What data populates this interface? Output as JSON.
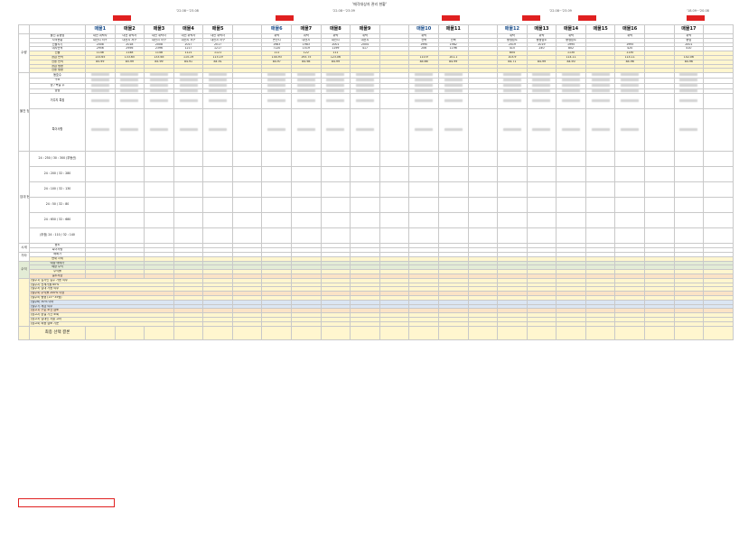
{
  "top_caption": "'매각대상자 관리 현황'",
  "dates": [
    "'22.08~'23.08",
    "'22.08~'23.09",
    "'22.08~'23.09",
    "'18.09~'20.08"
  ],
  "header": {
    "corner": "",
    "columns": [
      "매물1",
      "매물2",
      "매물3",
      "매물4",
      "매물5",
      "",
      "매물6",
      "매물7",
      "매물8",
      "매물9",
      "",
      "매물10",
      "매물11",
      "",
      "매물12",
      "매물13",
      "매물14",
      "매물15",
      "매물16",
      "",
      "매물17",
      ""
    ]
  },
  "sections": {
    "s1": "수량",
    "s2": "물건 정보",
    "s3": "임대 현황",
    "s4": "시세",
    "s5": "기타",
    "s6": "수익"
  },
  "rows": [
    {
      "label": "물건 유형명",
      "cells": [
        "대전 위탁사",
        "대전 위탁사",
        "대전 위탁사",
        "대전 위탁사",
        "대전 위탁사",
        "",
        "위탁",
        "위탁",
        "위탁",
        "위탁",
        "",
        "위탁",
        "",
        "",
        "위탁",
        "위탁",
        "위탁",
        "",
        "위탁",
        "",
        "위탁",
        ""
      ]
    },
    {
      "label": "지역현황",
      "cells": [
        "대전시 서구",
        "대전시 서구",
        "대전시 서구",
        "대전시 서구",
        "대전시 서구",
        "",
        "논산시",
        "대전시",
        "대전시",
        "대전시",
        "",
        "전북",
        "전북",
        "",
        "충청남도",
        "충청남도",
        "충청남도",
        "",
        "",
        "",
        "충남",
        ""
      ]
    },
    {
      "label": "건물시기",
      "cells": [
        "2008",
        "2018",
        "2008",
        "2017",
        "2017",
        "",
        "1983",
        "1983",
        "2001",
        "2004",
        "",
        "1990",
        "1982",
        "",
        "2019",
        "2019",
        "1995",
        "",
        "1995",
        "",
        "2001",
        ""
      ]
    },
    {
      "label": "대지면적",
      "cells": [
        "2956",
        "2956",
        "2396",
        "1217",
        "1217",
        "",
        "7120",
        "1519",
        "1199",
        "417",
        "",
        "206",
        "1196",
        "",
        "415",
        "240",
        "802",
        "",
        "420",
        "",
        "410",
        ""
      ]
    },
    {
      "label": "건물",
      "cells": [
        "1148",
        "1148",
        "1148",
        "1121",
        "1121",
        "",
        "111",
        "122",
        "111",
        "",
        "",
        "",
        "",
        "",
        "804",
        "",
        "1130",
        "",
        "1130",
        "",
        "",
        ""
      ]
    },
    {
      "label": "공급 면적",
      "cells": [
        "133.65",
        "133.65",
        "133.65",
        "115.19",
        "115.19",
        "",
        "144.93",
        "193.75",
        "123.06",
        "",
        "",
        "110.9",
        "101.1",
        "",
        "103.9",
        "",
        "114.11",
        "",
        "114.11",
        "",
        "102.06",
        ""
      ]
    },
    {
      "label": "전용 면적",
      "cells": [
        "85.99",
        "85.99",
        "85.99",
        "84.91",
        "84.91",
        "",
        "84.97",
        "84.98",
        "84.99",
        "",
        "",
        "84.66",
        "84.99",
        "",
        "84.71",
        "84.99",
        "84.90",
        "",
        "84.96",
        "",
        "84.96",
        ""
      ]
    },
    {
      "label": "공급 평형",
      "cells": [
        "",
        "",
        "",
        "",
        "",
        "",
        "",
        "",
        "",
        "",
        "",
        "",
        "",
        "",
        "",
        "",
        "",
        "",
        "",
        "",
        "",
        ""
      ]
    },
    {
      "label": "전용 평형",
      "cells": [
        "",
        "",
        "",
        "",
        "",
        "",
        "",
        "",
        "",
        "",
        "",
        "",
        "",
        "",
        "",
        "",
        "",
        "",
        "",
        "",
        "",
        ""
      ]
    },
    {
      "label": "동호수",
      "cells": [
        "",
        "",
        "",
        "",
        "",
        "",
        "",
        "",
        "",
        "",
        "",
        "",
        "",
        "",
        "",
        "",
        "",
        "",
        "",
        "",
        "",
        ""
      ]
    },
    {
      "label": "구조",
      "cells": [
        "",
        "",
        "",
        "",
        "",
        "",
        "",
        "",
        "",
        "",
        "",
        "",
        "",
        "",
        "",
        "",
        "",
        "",
        "",
        "",
        "",
        ""
      ]
    },
    {
      "label": "방 / 욕실 수",
      "cells": [
        "",
        "",
        "",
        "",
        "",
        "",
        "",
        "",
        "",
        "",
        "",
        "",
        "",
        "",
        "",
        "",
        "",
        "",
        "",
        "",
        "",
        ""
      ]
    },
    {
      "label": "방향",
      "cells": [
        "",
        "",
        "",
        "",
        "",
        "",
        "",
        "",
        "",
        "",
        "",
        "",
        "",
        "",
        "",
        "",
        "",
        "",
        "",
        "",
        "",
        ""
      ]
    },
    {
      "label": "거주지 특징",
      "cells": [
        "",
        "",
        "",
        "",
        "",
        "",
        "",
        "",
        "",
        "",
        "",
        "",
        "",
        "",
        "",
        "",
        "",
        "",
        "",
        "",
        "",
        ""
      ]
    },
    {
      "label": "특이사항",
      "cells": [
        "",
        "",
        "",
        "",
        "",
        "",
        "",
        "",
        "",
        "",
        "",
        "",
        "",
        "",
        "",
        "",
        "",
        "",
        "",
        "",
        "",
        ""
      ]
    },
    {
      "label": "24 : 250 / 30 : 300 (부동산)",
      "cells": [
        "",
        "",
        "",
        "",
        "",
        "",
        "",
        "",
        "",
        "",
        "",
        "",
        "",
        "",
        "",
        "",
        "",
        "",
        "",
        "",
        "",
        ""
      ]
    },
    {
      "label": "24 : 200 / 32 : 280",
      "cells": [
        "",
        "",
        "",
        "",
        "",
        "",
        "",
        "",
        "",
        "",
        "",
        "",
        "",
        "",
        "",
        "",
        "",
        "",
        "",
        "",
        "",
        ""
      ]
    },
    {
      "label": "24 : 100 / 32 : 130",
      "cells": [
        "",
        "",
        "",
        "",
        "",
        "",
        "",
        "",
        "",
        "",
        "",
        "",
        "",
        "",
        "",
        "",
        "",
        "",
        "",
        "",
        "",
        ""
      ]
    },
    {
      "label": "24 : 50 / 32 : 80",
      "cells": [
        "",
        "",
        "",
        "",
        "",
        "",
        "",
        "",
        "",
        "",
        "",
        "",
        "",
        "",
        "",
        "",
        "",
        "",
        "",
        "",
        "",
        ""
      ]
    },
    {
      "label": "24 : 650 / 32 : 680",
      "cells": [
        "",
        "",
        "",
        "",
        "",
        "",
        "",
        "",
        "",
        "",
        "",
        "",
        "",
        "",
        "",
        "",
        "",
        "",
        "",
        "",
        "",
        ""
      ]
    },
    {
      "label": "(추정) 24 : 110 / 32 : 140",
      "cells": [
        "",
        "",
        "",
        "",
        "",
        "",
        "",
        "",
        "",
        "",
        "",
        "",
        "",
        "",
        "",
        "",
        "",
        "",
        "",
        "",
        "",
        ""
      ]
    },
    {
      "label": "용도",
      "cells": [
        "",
        "",
        "",
        "",
        "",
        "",
        "",
        "",
        "",
        "",
        "",
        "",
        "",
        "",
        "",
        "",
        "",
        "",
        "",
        "",
        "",
        ""
      ]
    },
    {
      "label": "특이사항",
      "cells": [
        "",
        "",
        "",
        "",
        "",
        "",
        "",
        "",
        "",
        "",
        "",
        "",
        "",
        "",
        "",
        "",
        "",
        "",
        "",
        "",
        "",
        ""
      ]
    },
    {
      "label": "매매가",
      "cells": [
        "",
        "",
        "",
        "",
        "",
        "",
        "",
        "",
        "",
        "",
        "",
        "",
        "",
        "",
        "",
        "",
        "",
        "",
        "",
        "",
        "",
        ""
      ]
    },
    {
      "label": "현재 시세",
      "cells": [
        "",
        "",
        "",
        "",
        "",
        "",
        "",
        "",
        "",
        "",
        "",
        "",
        "",
        "",
        "",
        "",
        "",
        "",
        "",
        "",
        "",
        ""
      ]
    },
    {
      "label": "예상 매매가",
      "cells": [
        "",
        "",
        "",
        "",
        "",
        "",
        "",
        "",
        "",
        "",
        "",
        "",
        "",
        "",
        "",
        "",
        "",
        "",
        "",
        "",
        "",
        ""
      ]
    },
    {
      "label": "예상 수익",
      "cells": [
        "",
        "",
        "",
        "",
        "",
        "",
        "",
        "",
        "",
        "",
        "",
        "",
        "",
        "",
        "",
        "",
        "",
        "",
        "",
        "",
        "",
        ""
      ]
    },
    {
      "label": "수익률",
      "cells": [
        "",
        "",
        "",
        "",
        "",
        "",
        "",
        "",
        "",
        "",
        "",
        "",
        "",
        "",
        "",
        "",
        "",
        "",
        "",
        "",
        "",
        ""
      ]
    },
    {
      "label": "실투자금",
      "cells": [
        "",
        "",
        "",
        "",
        "",
        "",
        "",
        "",
        "",
        "",
        "",
        "",
        "",
        "",
        "",
        "",
        "",
        "",
        "",
        "",
        "",
        ""
      ]
    }
  ],
  "checklist": [
    "(필수1) 임차인 입주 가능 여부",
    "(필수2) 전세가율 80%",
    "(필수3) 임대 가능 여부",
    "(필수4) 수익률 200% 이상",
    "(필수5) 평형 (15~35평)",
    "(필수6) 30% 이하",
    "(필수7) 세금 여부",
    "(참고1) 구분 조건 검토",
    "(참고2) 공실 기간 조회",
    "(참고3) 임대인 지출 고려",
    "(참고4) 최종 검토 기준"
  ],
  "final_label": "최종 선택 결론",
  "colors": {
    "yellow": "#fff6cf",
    "green": "#e3ecd6",
    "orange": "#fbe3c6",
    "blue": "#dbe6f3",
    "red": "#e02020"
  }
}
